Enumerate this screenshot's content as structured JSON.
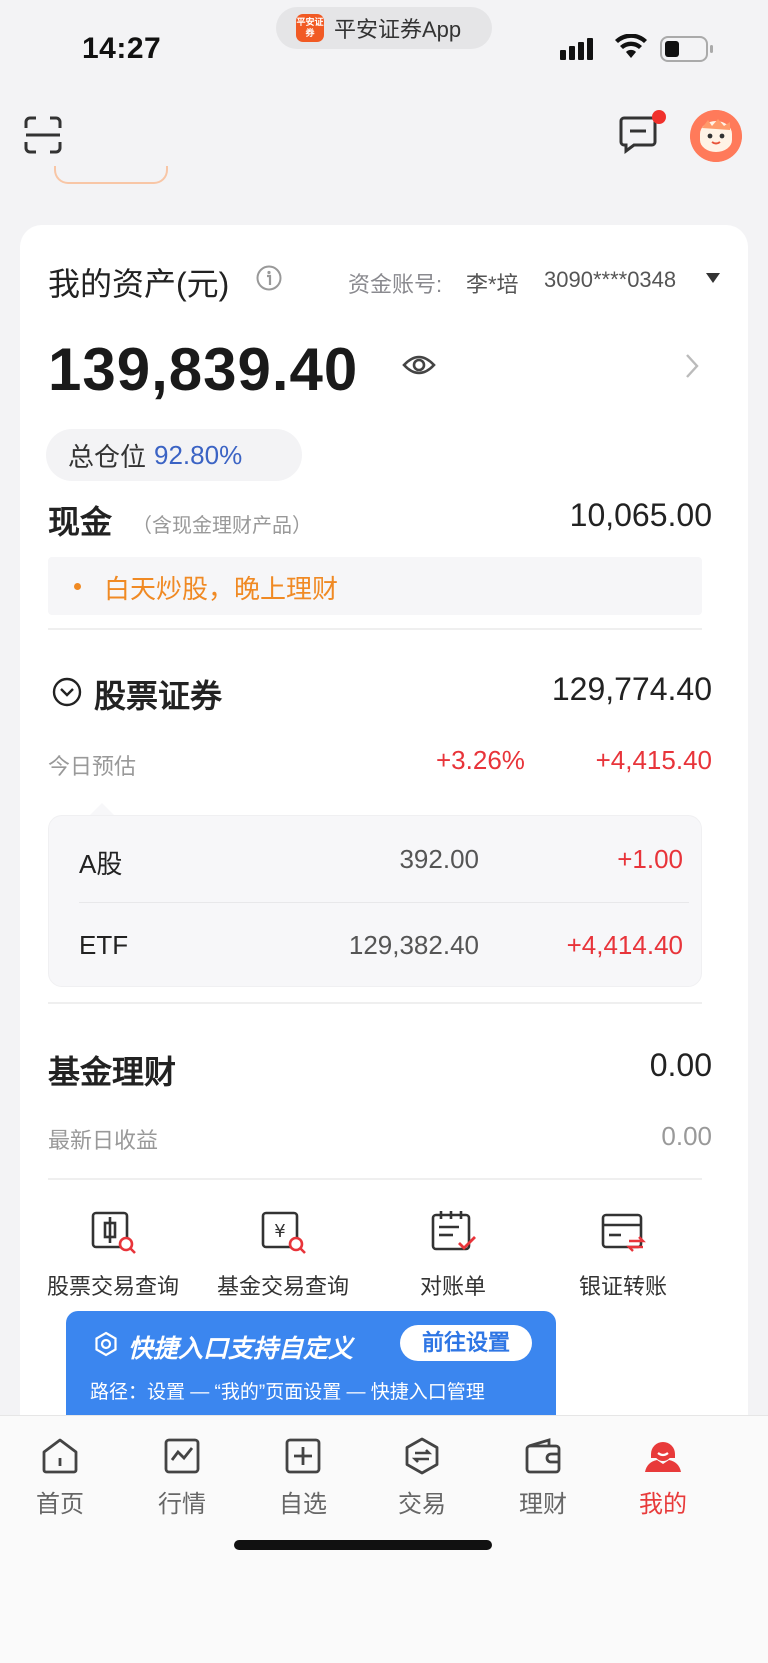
{
  "status_bar": {
    "time": "14:27",
    "app_logo_text": "平安证券",
    "app_name": "平安证券App"
  },
  "assets": {
    "title": "我的资产(元)",
    "account_label": "资金账号:",
    "account_name": "李*培",
    "account_number": "3090****0348",
    "total": "139,839.40",
    "position_label": "总仓位",
    "position_value": "92.80%"
  },
  "cash": {
    "title": "现金",
    "subtitle": "（含现金理财产品）",
    "value": "10,065.00",
    "promo": "白天炒股，晚上理财"
  },
  "stocks": {
    "title": "股票证券",
    "value": "129,774.40",
    "today_label": "今日预估",
    "today_pct": "+3.26%",
    "today_amount": "+4,415.40",
    "rows": [
      {
        "name": "A股",
        "value": "392.00",
        "change": "+1.00"
      },
      {
        "name": "ETF",
        "value": "129,382.40",
        "change": "+4,414.40"
      }
    ]
  },
  "fund": {
    "title": "基金理财",
    "value": "0.00",
    "daily_label": "最新日收益",
    "daily_value": "0.00"
  },
  "quick_actions": [
    {
      "label": "股票交易查询",
      "icon": "stock-query-icon"
    },
    {
      "label": "基金交易查询",
      "icon": "fund-query-icon"
    },
    {
      "label": "对账单",
      "icon": "statement-icon"
    },
    {
      "label": "银证转账",
      "icon": "bank-transfer-icon"
    }
  ],
  "tooltip": {
    "title": "快捷入口支持自定义",
    "button": "前往设置",
    "path": "路径：设置 — “我的”页面设置 — 快捷入口管理"
  },
  "tabbar": [
    {
      "label": "首页",
      "icon": "home-icon"
    },
    {
      "label": "行情",
      "icon": "market-icon"
    },
    {
      "label": "自选",
      "icon": "watchlist-icon"
    },
    {
      "label": "交易",
      "icon": "trade-icon"
    },
    {
      "label": "理财",
      "icon": "wallet-icon"
    },
    {
      "label": "我的",
      "icon": "profile-icon",
      "active": true
    }
  ],
  "colors": {
    "accent_red": "#e8343a",
    "accent_blue": "#3b63c4",
    "promo_orange": "#f08a24",
    "tooltip_blue": "#3b86ef"
  }
}
